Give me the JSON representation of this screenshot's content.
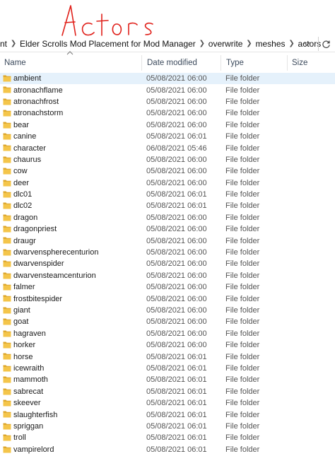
{
  "annotation": {
    "text": "Actors",
    "color": "#e0201a"
  },
  "breadcrumb": {
    "items": [
      "nt",
      "Elder Scrolls Mod Placement for Mod Manager",
      "overwrite",
      "meshes",
      "actors"
    ]
  },
  "columns": {
    "name": "Name",
    "date": "Date modified",
    "type": "Type",
    "size": "Size"
  },
  "colors": {
    "folder": "#f4c54a",
    "folder_dark": "#dca52a",
    "selected_row": "#e5f1fb"
  },
  "files": [
    {
      "name": "ambient",
      "date": "05/08/2021 06:00",
      "type": "File folder"
    },
    {
      "name": "atronachflame",
      "date": "05/08/2021 06:00",
      "type": "File folder"
    },
    {
      "name": "atronachfrost",
      "date": "05/08/2021 06:00",
      "type": "File folder"
    },
    {
      "name": "atronachstorm",
      "date": "05/08/2021 06:00",
      "type": "File folder"
    },
    {
      "name": "bear",
      "date": "05/08/2021 06:00",
      "type": "File folder"
    },
    {
      "name": "canine",
      "date": "05/08/2021 06:01",
      "type": "File folder"
    },
    {
      "name": "character",
      "date": "06/08/2021 05:46",
      "type": "File folder"
    },
    {
      "name": "chaurus",
      "date": "05/08/2021 06:00",
      "type": "File folder"
    },
    {
      "name": "cow",
      "date": "05/08/2021 06:00",
      "type": "File folder"
    },
    {
      "name": "deer",
      "date": "05/08/2021 06:00",
      "type": "File folder"
    },
    {
      "name": "dlc01",
      "date": "05/08/2021 06:01",
      "type": "File folder"
    },
    {
      "name": "dlc02",
      "date": "05/08/2021 06:01",
      "type": "File folder"
    },
    {
      "name": "dragon",
      "date": "05/08/2021 06:00",
      "type": "File folder"
    },
    {
      "name": "dragonpriest",
      "date": "05/08/2021 06:00",
      "type": "File folder"
    },
    {
      "name": "draugr",
      "date": "05/08/2021 06:00",
      "type": "File folder"
    },
    {
      "name": "dwarvenspherecenturion",
      "date": "05/08/2021 06:00",
      "type": "File folder"
    },
    {
      "name": "dwarvenspider",
      "date": "05/08/2021 06:00",
      "type": "File folder"
    },
    {
      "name": "dwarvensteamcenturion",
      "date": "05/08/2021 06:00",
      "type": "File folder"
    },
    {
      "name": "falmer",
      "date": "05/08/2021 06:00",
      "type": "File folder"
    },
    {
      "name": "frostbitespider",
      "date": "05/08/2021 06:00",
      "type": "File folder"
    },
    {
      "name": "giant",
      "date": "05/08/2021 06:00",
      "type": "File folder"
    },
    {
      "name": "goat",
      "date": "05/08/2021 06:00",
      "type": "File folder"
    },
    {
      "name": "hagraven",
      "date": "05/08/2021 06:00",
      "type": "File folder"
    },
    {
      "name": "horker",
      "date": "05/08/2021 06:00",
      "type": "File folder"
    },
    {
      "name": "horse",
      "date": "05/08/2021 06:01",
      "type": "File folder"
    },
    {
      "name": "icewraith",
      "date": "05/08/2021 06:01",
      "type": "File folder"
    },
    {
      "name": "mammoth",
      "date": "05/08/2021 06:01",
      "type": "File folder"
    },
    {
      "name": "sabrecat",
      "date": "05/08/2021 06:01",
      "type": "File folder"
    },
    {
      "name": "skeever",
      "date": "05/08/2021 06:01",
      "type": "File folder"
    },
    {
      "name": "slaughterfish",
      "date": "05/08/2021 06:01",
      "type": "File folder"
    },
    {
      "name": "spriggan",
      "date": "05/08/2021 06:01",
      "type": "File folder"
    },
    {
      "name": "troll",
      "date": "05/08/2021 06:01",
      "type": "File folder"
    },
    {
      "name": "vampirelord",
      "date": "05/08/2021 06:01",
      "type": "File folder"
    }
  ]
}
